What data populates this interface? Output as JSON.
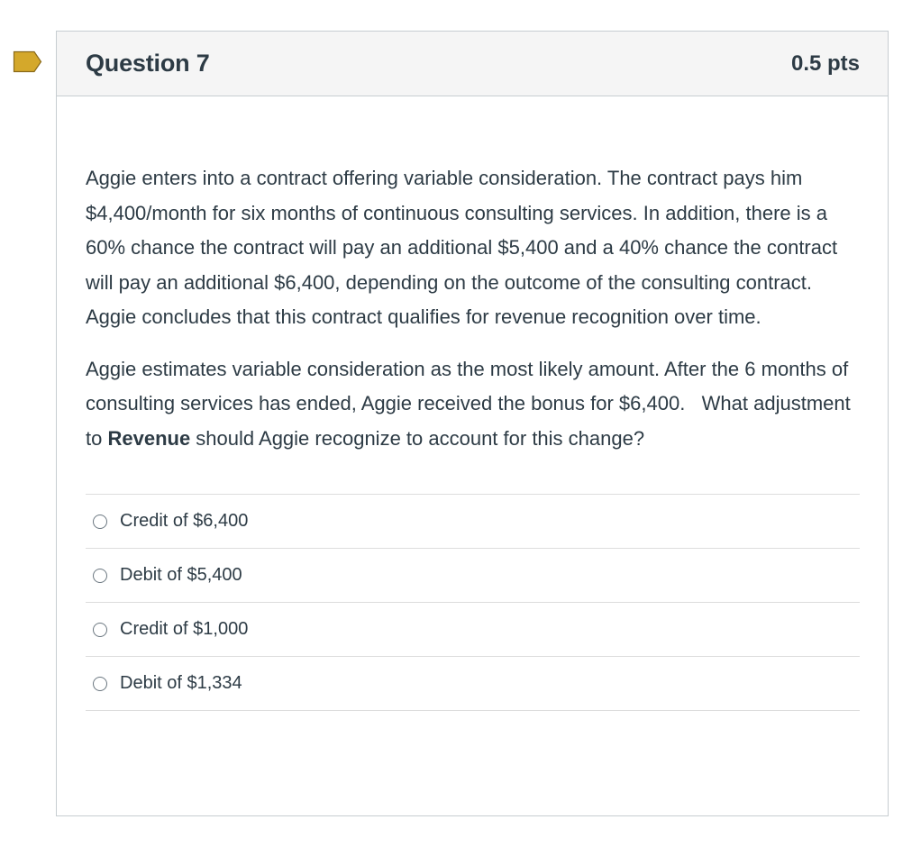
{
  "question": {
    "title": "Question 7",
    "points": "0.5 pts",
    "paragraph1": "Aggie enters into a contract offering variable consideration. The contract pays him $4,400/month for six months of continuous consulting services. In addition, there is a 60% chance the contract will pay an additional $5,400 and a 40% chance the contract will pay an additional $6,400, depending on the outcome of the consulting contract. Aggie concludes that this contract qualifies for revenue recognition over time.",
    "paragraph2_before": "Aggie estimates variable consideration as the most likely amount. After the 6 months of consulting services has ended, Aggie received the bonus for $6,400.   What adjustment to ",
    "paragraph2_bold": "Revenue",
    "paragraph2_after": " should Aggie recognize to account for this change?",
    "flag_icon": "bookmark-flag-icon",
    "flag_color": "#d4a82b"
  },
  "answers": [
    {
      "label": "Credit of $6,400",
      "selected": false
    },
    {
      "label": "Debit of $5,400",
      "selected": false
    },
    {
      "label": "Credit of $1,000",
      "selected": false
    },
    {
      "label": "Debit of $1,334",
      "selected": false
    }
  ],
  "colors": {
    "text": "#2d3b45",
    "header_bg": "#f5f5f5",
    "border": "#c7cdd1",
    "divider": "#dddddd"
  }
}
